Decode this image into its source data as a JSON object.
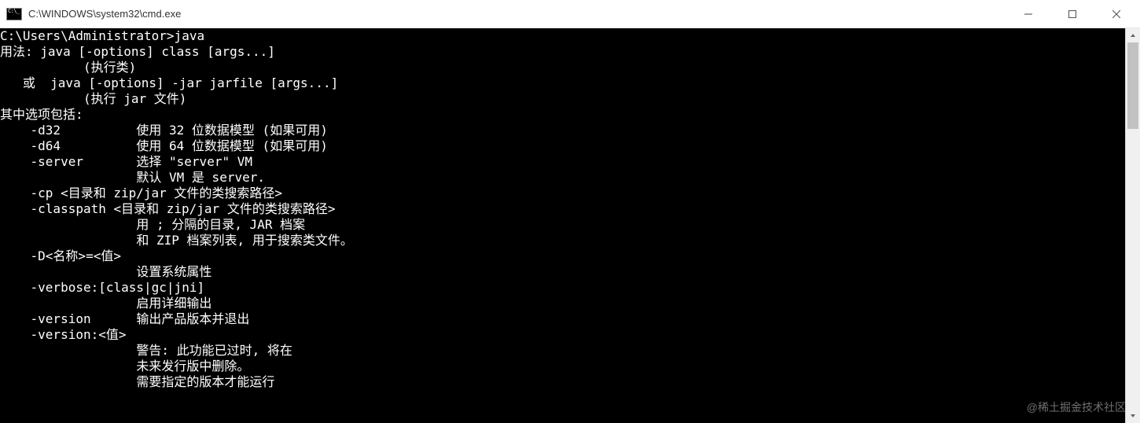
{
  "window": {
    "title": "C:\\WINDOWS\\system32\\cmd.exe"
  },
  "terminal": {
    "lines": [
      "",
      "C:\\Users\\Administrator>java",
      "用法: java [-options] class [args...]",
      "           (执行类)",
      "   或  java [-options] -jar jarfile [args...]",
      "           (执行 jar 文件)",
      "其中选项包括:",
      "    -d32          使用 32 位数据模型 (如果可用)",
      "    -d64          使用 64 位数据模型 (如果可用)",
      "    -server       选择 \"server\" VM",
      "                  默认 VM 是 server.",
      "",
      "    -cp <目录和 zip/jar 文件的类搜索路径>",
      "    -classpath <目录和 zip/jar 文件的类搜索路径>",
      "                  用 ; 分隔的目录, JAR 档案",
      "                  和 ZIP 档案列表, 用于搜索类文件。",
      "    -D<名称>=<值>",
      "                  设置系统属性",
      "    -verbose:[class|gc|jni]",
      "                  启用详细输出",
      "    -version      输出产品版本并退出",
      "    -version:<值>",
      "                  警告: 此功能已过时, 将在",
      "                  未来发行版中删除。",
      "                  需要指定的版本才能运行"
    ]
  },
  "watermark": "@稀土掘金技术社区"
}
